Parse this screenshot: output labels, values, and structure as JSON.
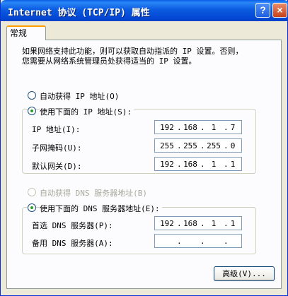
{
  "window": {
    "title": "Internet 协议 (TCP/IP) 属性",
    "help_label": "?",
    "close_label": "×"
  },
  "tabs": [
    {
      "label": "常规"
    }
  ],
  "info_line1": "如果网络支持此功能，则可以获取自动指派的 IP 设置。否则，",
  "info_line2": "您需要从网络系统管理员处获得适当的 IP 设置。",
  "ip_section": {
    "auto_label": "自动获得 IP 地址(O)",
    "manual_label": "使用下面的 IP 地址(S):",
    "fields": [
      {
        "label": "IP 地址(I):",
        "octets": [
          "192",
          "168",
          "1",
          "7"
        ]
      },
      {
        "label": "子网掩码(U):",
        "octets": [
          "255",
          "255",
          "255",
          "0"
        ]
      },
      {
        "label": "默认网关(D):",
        "octets": [
          "192",
          "168",
          "1",
          "1"
        ]
      }
    ]
  },
  "dns_section": {
    "auto_label": "自动获得 DNS 服务器地址(B)",
    "manual_label": "使用下面的 DNS 服务器地址(E):",
    "fields": [
      {
        "label": "首选 DNS 服务器(P):",
        "octets": [
          "192",
          "168",
          "1",
          "1"
        ]
      },
      {
        "label": "备用 DNS 服务器(A):",
        "octets": [
          "",
          "",
          "",
          ""
        ]
      }
    ]
  },
  "advanced_label": "高级(V)..."
}
